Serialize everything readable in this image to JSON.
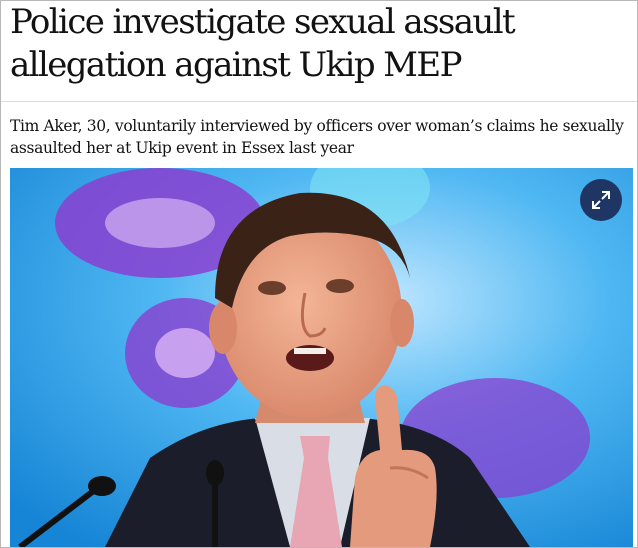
{
  "article": {
    "headline": "Police investigate sexual assault allegation against Ukip MEP",
    "standfirst": "Tim Aker, 30, voluntarily interviewed by officers over woman’s claims he sexually assaulted her at Ukip event in Essex last year"
  },
  "image": {
    "expand_icon": "expand-icon",
    "colors": {
      "background_blue": "#1d9ee6",
      "purple": "#8a3fd0",
      "suit": "#1b1d2a",
      "tie": "#e8a6b4",
      "expand_button": "#1f3564"
    }
  }
}
